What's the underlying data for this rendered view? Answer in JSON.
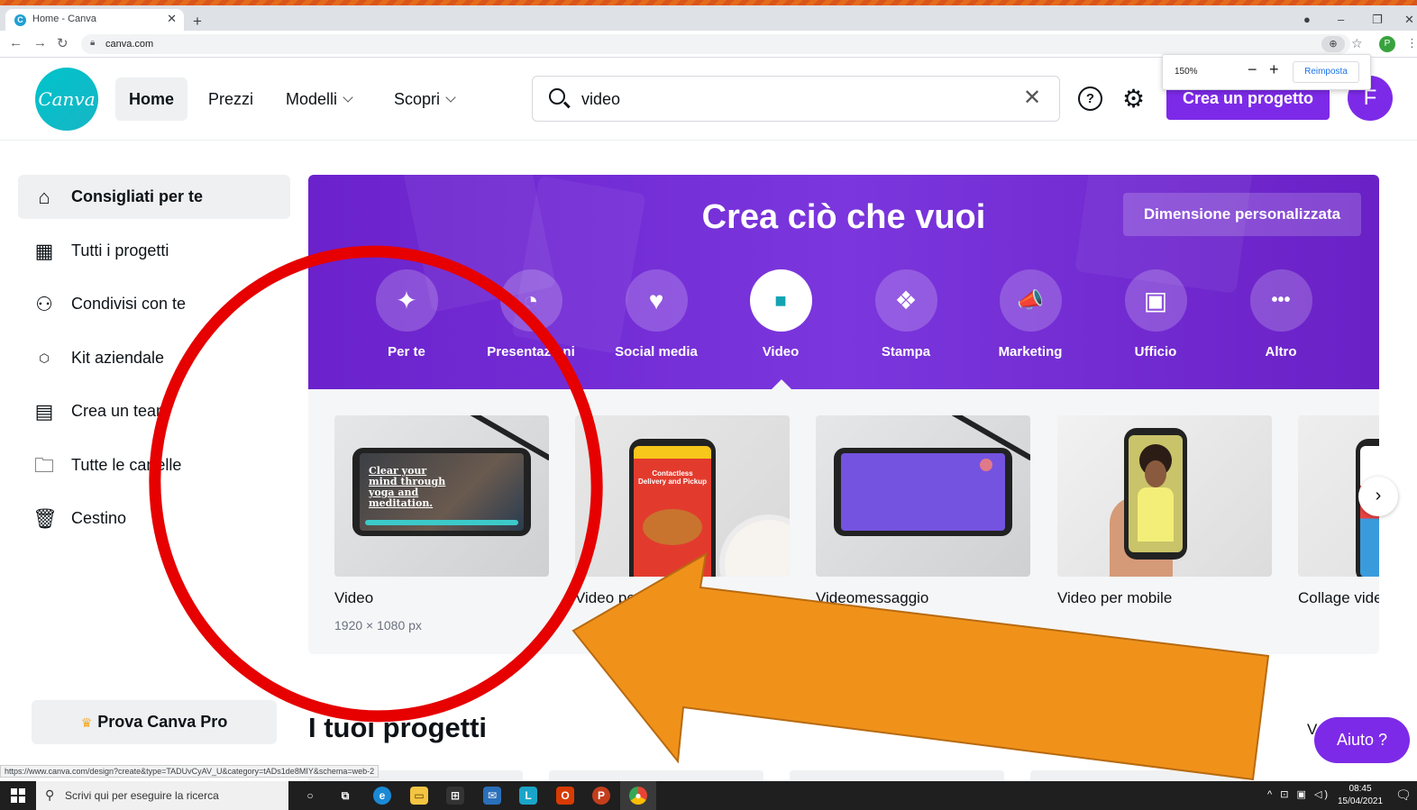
{
  "browser": {
    "tab_title": "Home - Canva",
    "tab_favicon": "C",
    "url": "canva.com",
    "status_url": "https://www.canva.com/design?create&type=TADUvCyAV_U&category=tADs1de8MIY&schema=web-2",
    "zoom_popup": {
      "value": "150%",
      "minus": "−",
      "plus": "+",
      "reset_label": "Reimposta"
    },
    "profile_initial": "P"
  },
  "header": {
    "logo_text": "Canva",
    "nav": [
      {
        "label": "Home",
        "active": true
      },
      {
        "label": "Prezzi"
      },
      {
        "label": "Modelli",
        "dropdown": true
      },
      {
        "label": "Scopri",
        "dropdown": true
      }
    ],
    "search": {
      "value": "video",
      "placeholder": ""
    },
    "help_glyph": "?",
    "create_button": "Crea un progetto",
    "avatar_initial": "F"
  },
  "sidebar": {
    "items": [
      {
        "label": "Consigliati per te",
        "icon": "home-icon",
        "active": true
      },
      {
        "label": "Tutti i progetti",
        "icon": "grid-icon"
      },
      {
        "label": "Condivisi con te",
        "icon": "shared-users-icon"
      },
      {
        "label": "Kit aziendale",
        "icon": "brand-kit-icon"
      },
      {
        "label": "Crea un team",
        "icon": "team-building-icon"
      },
      {
        "label": "Tutte le cartelle",
        "icon": "folder-icon"
      },
      {
        "label": "Cestino",
        "icon": "trash-icon"
      }
    ],
    "pro_cta": "Prova Canva Pro"
  },
  "banner": {
    "title": "Crea ciò che vuoi",
    "custom_size_button": "Dimensione personalizzata",
    "categories": [
      {
        "label": "Per te",
        "icon": "sparkle-icon",
        "glyph": "✦"
      },
      {
        "label": "Presentazioni",
        "icon": "presentation-icon",
        "glyph": "◔"
      },
      {
        "label": "Social media",
        "icon": "heart-chat-icon",
        "glyph": "♥"
      },
      {
        "label": "Video",
        "icon": "video-camera-icon",
        "glyph": "■",
        "selected": true
      },
      {
        "label": "Stampa",
        "icon": "print-icon",
        "glyph": "❖"
      },
      {
        "label": "Marketing",
        "icon": "megaphone-icon",
        "glyph": "📣"
      },
      {
        "label": "Ufficio",
        "icon": "briefcase-icon",
        "glyph": "▣"
      },
      {
        "label": "Altro",
        "icon": "more-icon",
        "glyph": "•••"
      }
    ]
  },
  "templates": [
    {
      "name": "Video",
      "dimensions": "1920 × 1080 px",
      "thumb_text": "Clear your mind through yoga and meditation."
    },
    {
      "name": "Video per Instagram",
      "dimensions": "",
      "thumb_text": "Contactless Delivery and Pickup"
    },
    {
      "name": "Videomessaggio",
      "dimensions": ""
    },
    {
      "name": "Video per mobile",
      "dimensions": ""
    },
    {
      "name": "Collage video",
      "dimensions": ""
    }
  ],
  "next_arrow": "›",
  "projects": {
    "title": "I tuoi progetti",
    "view_all_fragment": "V"
  },
  "help_button": "Aiuto ?",
  "taskbar": {
    "search_placeholder": "Scrivi qui per eseguire la ricerca",
    "time": "08:45",
    "date": "15/04/2021"
  },
  "colors": {
    "accent": "#7d2ae8",
    "banner": "#6b22cc",
    "canva_teal": "#00c4cc",
    "annotation_red": "#e60000",
    "annotation_orange": "#f0921a"
  }
}
